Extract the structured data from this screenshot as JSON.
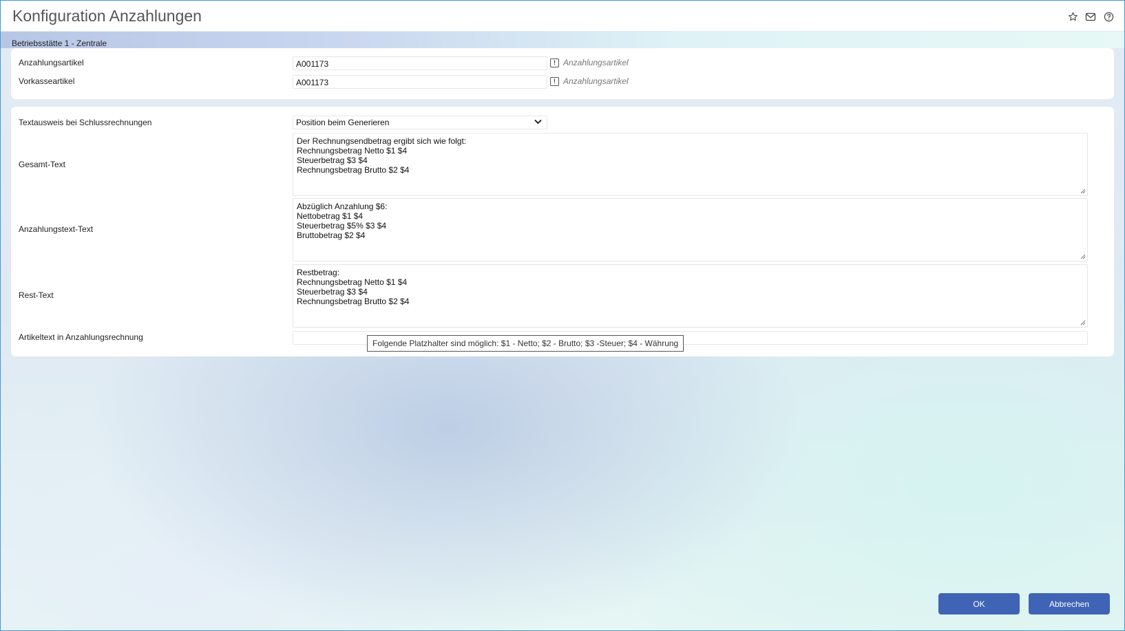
{
  "window": {
    "title": "Konfiguration Anzahlungen",
    "icons": [
      "star-icon",
      "mail-icon",
      "help-icon"
    ]
  },
  "section": {
    "header": "Betriebsstätte 1 - Zentrale"
  },
  "articles": [
    {
      "label": "Anzahlungsartikel",
      "value": "A001173",
      "hint": "Anzahlungsartikel"
    },
    {
      "label": "Vorkasseartikel",
      "value": "A001173",
      "hint": "Anzahlungsartikel"
    }
  ],
  "text_config": {
    "textausweis_label": "Textausweis bei Schlussrechnungen",
    "textausweis_value": "Position beim Generieren",
    "gesamt": {
      "label": "Gesamt-Text",
      "lines": [
        "Der Rechnungsendbetrag ergibt sich wie folgt:",
        "Rechnungsbetrag Netto $1 $4",
        "Steuerbetrag $3 $4",
        "Rechnungsbetrag Brutto $2 $4"
      ]
    },
    "anzahlung": {
      "label": "Anzahlungstext-Text",
      "lines": [
        "Abzüglich Anzahlung $6:",
        "Nettobetrag $1 $4",
        "Steuerbetrag $5% $3 $4",
        "Bruttobetrag $2 $4"
      ]
    },
    "rest": {
      "label": "Rest-Text",
      "lines": [
        "Restbetrag:",
        "Rechnungsbetrag Netto $1 $4",
        "Steuerbetrag $3 $4",
        "Rechnungsbetrag Brutto $2 $4"
      ]
    },
    "artikeltext": {
      "label": "Artikeltext in Anzahlungsrechnung",
      "value": ""
    }
  },
  "tooltip": "Folgende Platzhalter sind möglich: $1 - Netto; $2 - Brutto; $3 -Steuer; $4 - Währung",
  "buttons": {
    "ok": "OK",
    "cancel": "Abbrechen"
  },
  "colors": {
    "accent": "#3f63b5",
    "frame_border": "#3a9ad9"
  }
}
